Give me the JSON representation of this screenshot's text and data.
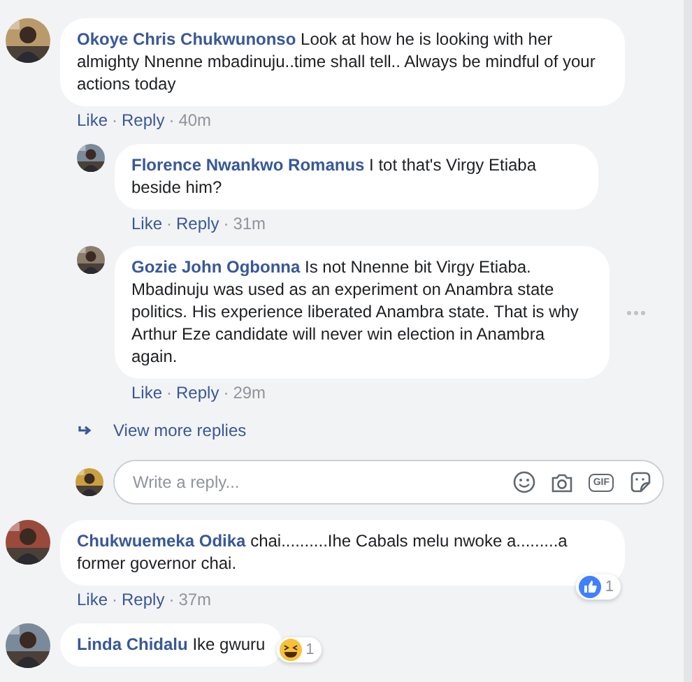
{
  "comments": [
    {
      "author": "Okoye Chris Chukwunonso",
      "text": "Look at how he is looking with her almighty Nnenne mbadinuju..time shall tell.. Always be mindful of your actions today",
      "like": "Like",
      "separators": [
        "·",
        "·"
      ],
      "reply": "Reply",
      "time": "40m",
      "replies": [
        {
          "author": "Florence Nwankwo Romanus",
          "text": "I tot that's Virgy Etiaba beside him?",
          "like": "Like",
          "separators": [
            "·",
            "·"
          ],
          "reply": "Reply",
          "time": "31m",
          "menu": false
        },
        {
          "author": "Gozie John Ogbonna",
          "text": "Is not Nnenne bit Virgy Etiaba. Mbadinuju was used as an experiment on Anambra state politics. His experience liberated Anambra state. That is why Arthur Eze candidate will never win election in Anambra again.",
          "like": "Like",
          "separators": [
            "·",
            "·"
          ],
          "reply": "Reply",
          "time": "29m",
          "menu": true
        }
      ],
      "view_more": "View more replies",
      "composer": {
        "placeholder": "Write a reply...",
        "gif_label": "GIF"
      }
    },
    {
      "author": "Chukwuemeka Odika",
      "text": "chai..........Ihe Cabals melu nwoke a.........a former governor chai.",
      "like": "Like",
      "separators": [
        "·",
        "·"
      ],
      "reply": "Reply",
      "time": "37m",
      "reaction": {
        "kind": "like",
        "count": "1"
      }
    },
    {
      "author": "Linda Chidalu",
      "text": "Ike gwuru",
      "reaction": {
        "kind": "haha",
        "count": "1"
      }
    }
  ]
}
